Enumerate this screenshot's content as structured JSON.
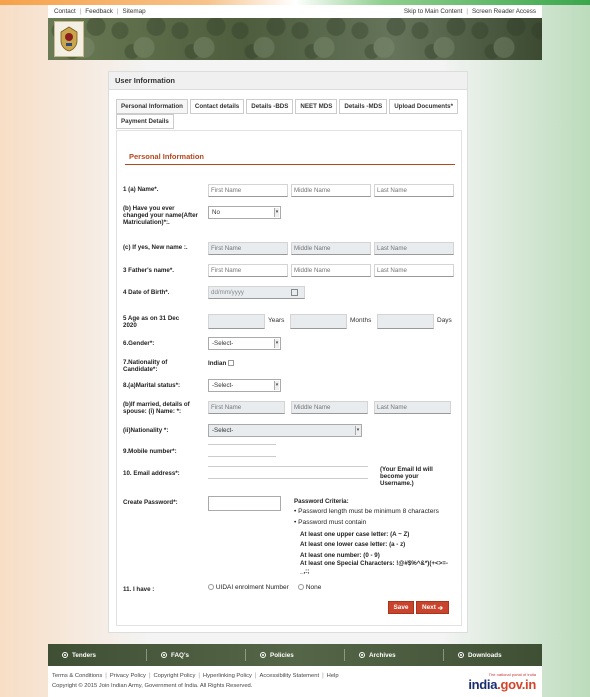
{
  "top_links": {
    "left": [
      "Contact",
      "Feedback",
      "Sitemap"
    ],
    "skip": "Skip to Main Content",
    "screen_reader": "Screen Reader Access"
  },
  "panel": {
    "title": "User Information"
  },
  "tabs": [
    "Personal Information",
    "Contact details",
    "Details -BDS",
    "NEET MDS",
    "Details -MDS",
    "Upload Documents*",
    "Payment Details"
  ],
  "section_title": "Personal Information",
  "form": {
    "name_label": "1 (a) Name*.",
    "first_ph": "First Name",
    "middle_ph": "Middle Name",
    "last_ph": "Last Name",
    "changed_label": "(b) Have you ever changed your name(After Matriculation)*:.",
    "changed_value": "No",
    "new_name_label": "(c) If yes, New name :.",
    "father_label": "3 Father's name*.",
    "dob_label": "4 Date of Birth*.",
    "dob_ph": "dd/mm/yyyy",
    "age_label": "5 Age as on 31 Dec 2020",
    "years": "Years",
    "months": "Months",
    "days": "Days",
    "gender_label": "6.Gender*:",
    "select_ph": "-Select-",
    "nationality_label": "7.Nationality of Candidate*:",
    "indian": "Indian",
    "marital_label": "8.(a)Marital status*:",
    "spouse_label": "(b)If married, details of spouse: (i) Name: *:",
    "spouse_nat_label": "(ii)Nationality *:",
    "mobile_label": "9.Mobile number*:",
    "email_label": "10. Email address*:",
    "email_note": "(Your Email Id will become your Username.)",
    "password_label": "Create Password*:",
    "criteria_title": "Password Criteria:",
    "criteria": [
      "Password length must be minimum 8 characters",
      "Password must contain"
    ],
    "criteria_bold": [
      "At least one upper case letter: (A ~ Z)",
      "At least one lower case letter: (a - z)",
      "At least one number: (0 - 9)",
      "At least one Special Characters: !@#$%^&*)(+<>=-_,:;"
    ],
    "have_label": "11. I have :",
    "uidai": "UIDAI enrolment Number",
    "none": "None",
    "save": "Save",
    "next": "Next"
  },
  "footer": {
    "items": [
      "Tenders",
      "FAQ's",
      "Policies",
      "Archives",
      "Downloads"
    ],
    "links": [
      "Terms & Conditions",
      "Privacy Policy",
      "Copyright Policy",
      "Hyperlinking Policy",
      "Accessibility Statement",
      "Help"
    ],
    "copyright": "Copyright © 2015 Join Indian Army, Government of India. All Rights Reserved.",
    "igi_tag": "The national portal of India",
    "igi_logo_a": "india",
    "igi_logo_b": ".gov.in"
  }
}
